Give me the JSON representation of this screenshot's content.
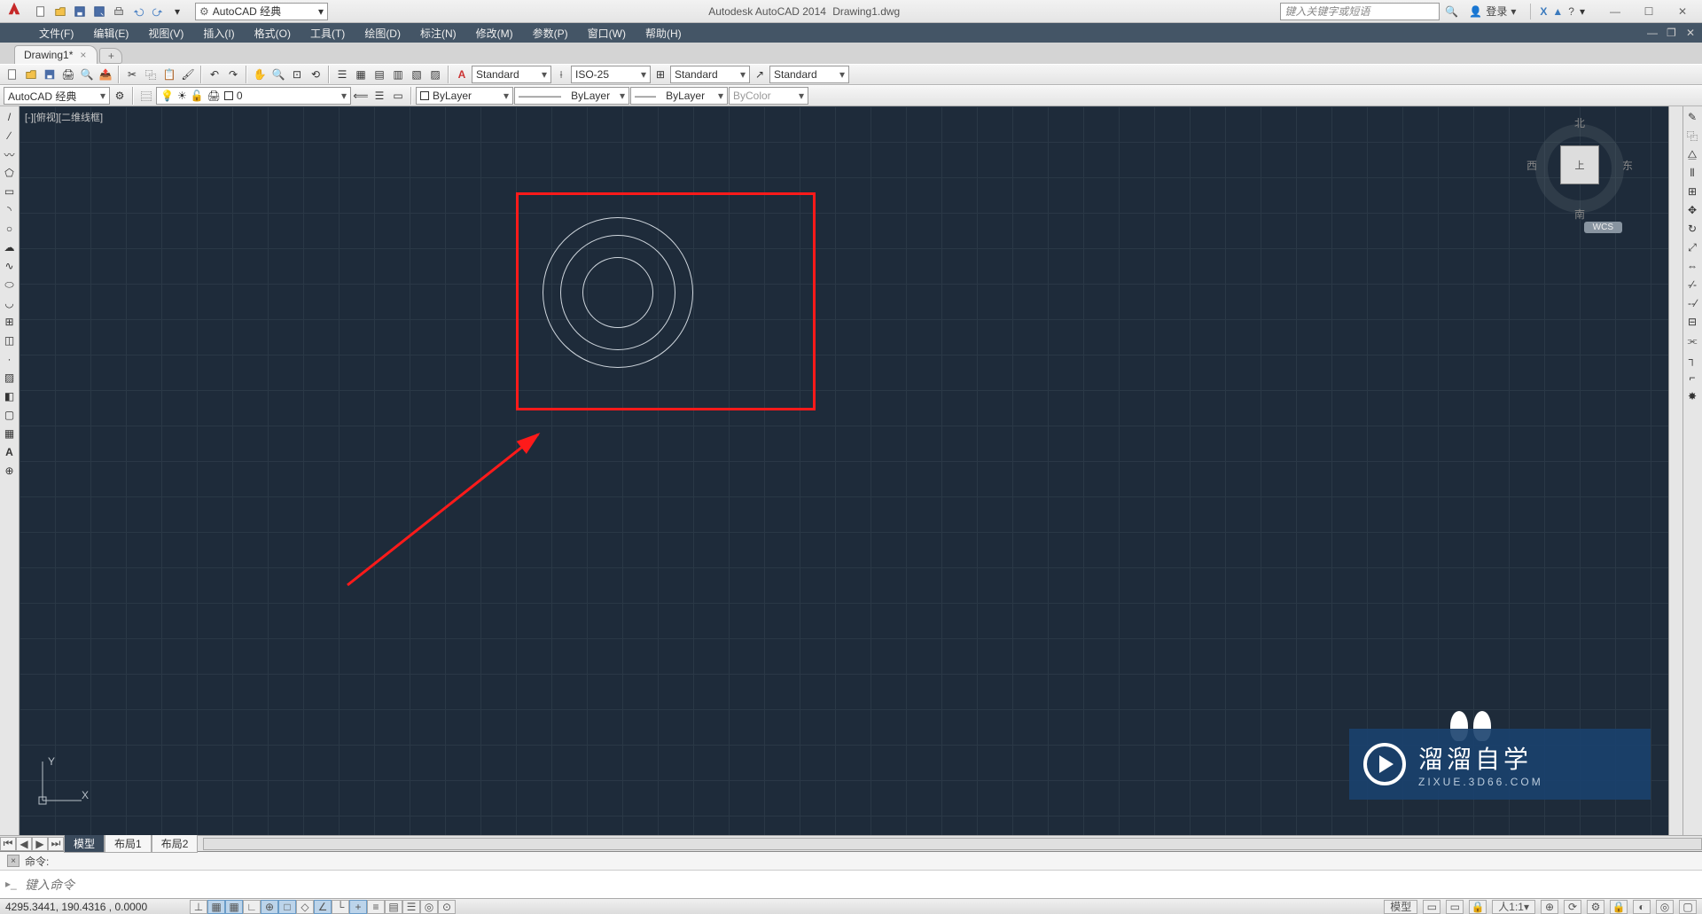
{
  "title": {
    "app": "Autodesk AutoCAD 2014",
    "file": "Drawing1.dwg"
  },
  "workspace": "AutoCAD 经典",
  "search_placeholder": "键入关键字或短语",
  "login_label": "登录",
  "menubar": [
    "文件(F)",
    "编辑(E)",
    "视图(V)",
    "插入(I)",
    "格式(O)",
    "工具(T)",
    "绘图(D)",
    "标注(N)",
    "修改(M)",
    "参数(P)",
    "窗口(W)",
    "帮助(H)"
  ],
  "filetab": {
    "name": "Drawing1*",
    "close": "×",
    "plus": "+"
  },
  "toolbar_top": {
    "text_style": "Standard",
    "dim_style": "ISO-25",
    "table_style": "Standard",
    "mleader_style": "Standard"
  },
  "toolbar_second": {
    "workspace": "AutoCAD 经典",
    "layer": "0",
    "color": "ByLayer",
    "linetype": "ByLayer",
    "lineweight": "ByLayer",
    "plotstyle": "ByColor"
  },
  "viewport_label": "[-][俯视][二维线框]",
  "viewcube": {
    "n": "北",
    "s": "南",
    "e": "东",
    "w": "西",
    "top": "上",
    "wcs": "WCS"
  },
  "ucs": {
    "x": "X",
    "y": "Y"
  },
  "layout_tabs": {
    "model": "模型",
    "layout1": "布局1",
    "layout2": "布局2"
  },
  "command": {
    "history": "命令:",
    "placeholder": "键入命令"
  },
  "status": {
    "coords": "4295.3441, 190.4316 , 0.0000",
    "model": "模型",
    "scale": "1:1"
  },
  "watermark": {
    "t1": "溜溜自学",
    "t2": "ZIXUE.3D66.COM"
  }
}
